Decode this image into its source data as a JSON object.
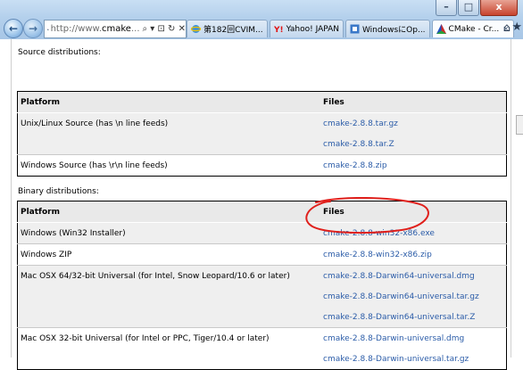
{
  "browser": {
    "url_prefix": "http://www.",
    "url_domain": "cmake",
    "url_suffix": "...",
    "address_icons": "⌕ ▾ ⊡ ↻ ✕",
    "tabs": [
      {
        "label": "第182回CVIM...",
        "icon": "ie-icon"
      },
      {
        "label": "Yahoo! JAPAN",
        "icon": "yahoo-icon"
      },
      {
        "label": "WindowsにOp...",
        "icon": "page-icon"
      },
      {
        "label": "CMake - Cr...",
        "icon": "cmake-icon",
        "active": true
      }
    ],
    "min_label": "–",
    "max_label": "□",
    "close_label": "x",
    "back_glyph": "←",
    "forward_glyph": "→",
    "home_glyph": "⌂",
    "fav_glyph": "★",
    "close_tab_glyph": "×"
  },
  "source": {
    "title": "Source distributions:",
    "col_platform": "Platform",
    "col_files": "Files",
    "rows": [
      {
        "platform": "Unix/Linux Source (has \\n line feeds)",
        "files": [
          "cmake-2.8.8.tar.gz",
          "cmake-2.8.8.tar.Z"
        ]
      },
      {
        "platform": "Windows Source (has \\r\\n line feeds)",
        "files": [
          "cmake-2.8.8.zip"
        ]
      }
    ]
  },
  "binary": {
    "title": "Binary distributions:",
    "col_platform": "Platform",
    "col_files": "Files",
    "rows": [
      {
        "platform": "Windows (Win32 Installer)",
        "files": [
          "cmake-2.8.8-win32-x86.exe"
        ]
      },
      {
        "platform": "Windows ZIP",
        "files": [
          "cmake-2.8.8-win32-x86.zip"
        ]
      },
      {
        "platform": "Mac OSX 64/32-bit Universal (for Intel, Snow Leopard/10.6 or later)",
        "files": [
          "cmake-2.8.8-Darwin64-universal.dmg",
          "cmake-2.8.8-Darwin64-universal.tar.gz",
          "cmake-2.8.8-Darwin64-universal.tar.Z"
        ]
      },
      {
        "platform": "Mac OSX 32-bit Universal (for Intel or PPC, Tiger/10.4 or later)",
        "files": [
          "cmake-2.8.8-Darwin-universal.dmg",
          "cmake-2.8.8-Darwin-universal.tar.gz"
        ]
      }
    ]
  },
  "colors": {
    "link": "#2b5ca8",
    "annotation": "#e0201c",
    "header_bg": "#e9e9e9",
    "row_shade": "#efefef"
  }
}
